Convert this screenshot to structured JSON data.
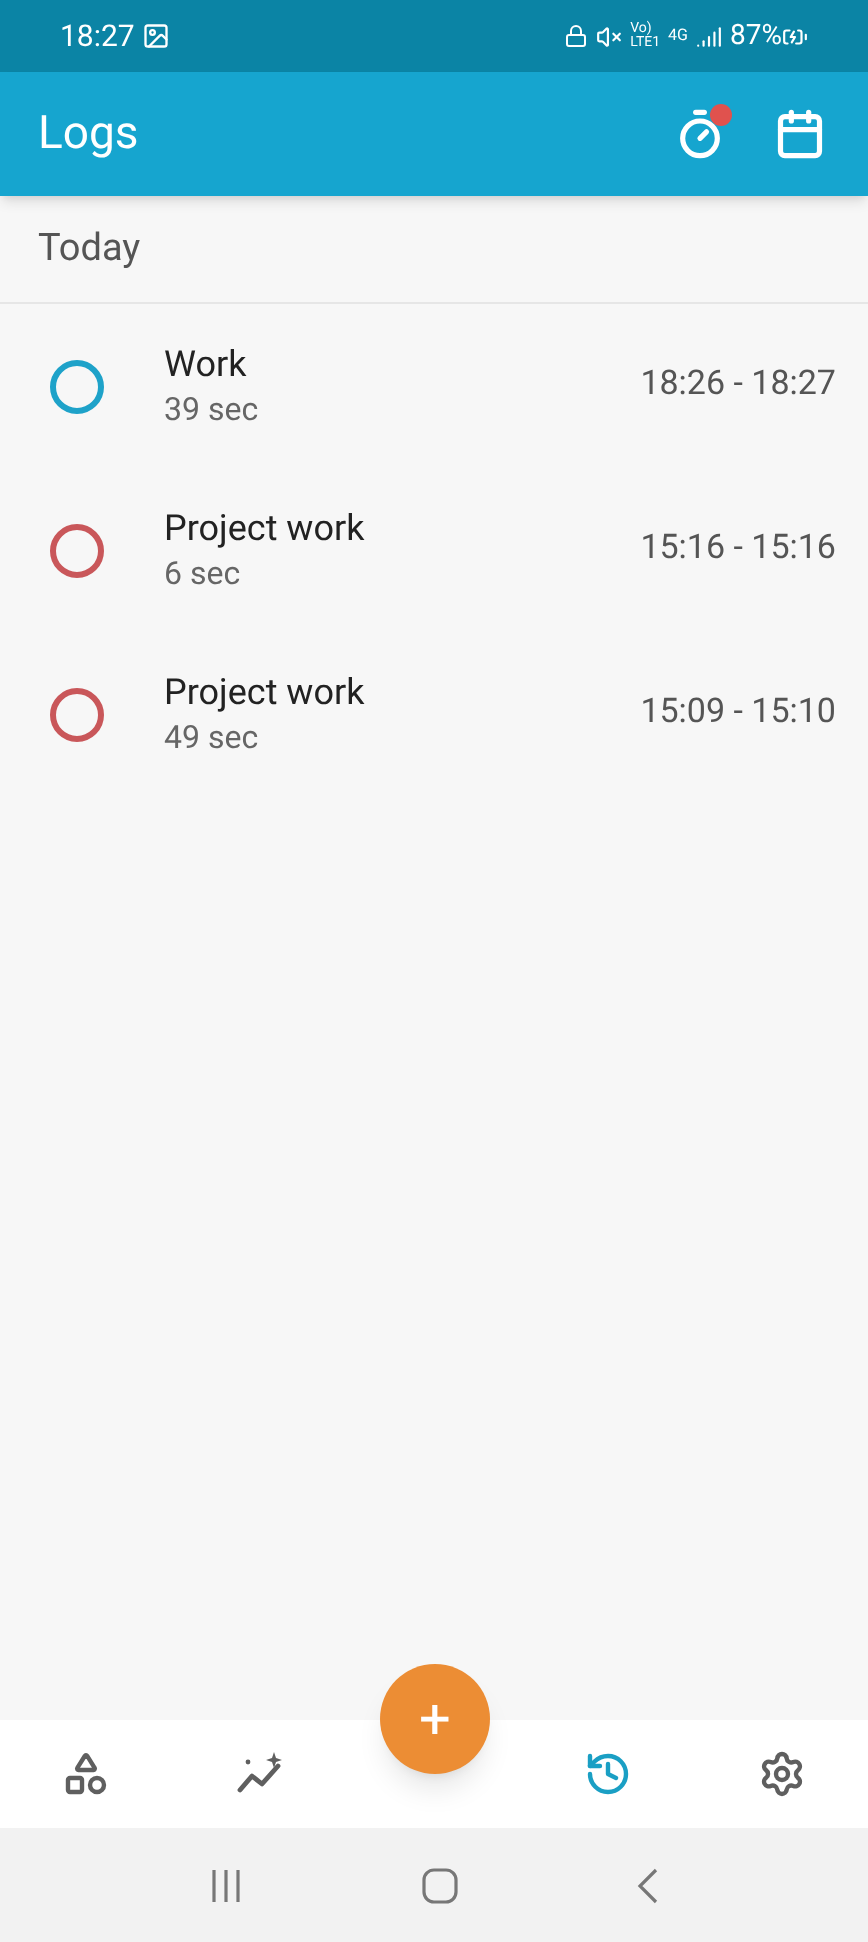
{
  "status_bar": {
    "time": "18:27",
    "network_labels": [
      "Vo)",
      "LTE1",
      "4G"
    ],
    "battery": "87%"
  },
  "app_bar": {
    "title": "Logs",
    "timer_badge": true
  },
  "section": {
    "title": "Today"
  },
  "logs": [
    {
      "name": "Work",
      "duration": "39 sec",
      "time_range": "18:26 - 18:27",
      "color": "#1ea2c9"
    },
    {
      "name": "Project work",
      "duration": "6 sec",
      "time_range": "15:16 - 15:16",
      "color": "#c9575a"
    },
    {
      "name": "Project work",
      "duration": "49 sec",
      "time_range": "15:09 - 15:10",
      "color": "#c9575a"
    }
  ],
  "fab": {
    "label": "+"
  },
  "bottom_nav": [
    {
      "kind": "categories",
      "selected": false
    },
    {
      "kind": "stats",
      "selected": false
    },
    {
      "kind": "history",
      "selected": true
    },
    {
      "kind": "settings",
      "selected": false
    }
  ]
}
